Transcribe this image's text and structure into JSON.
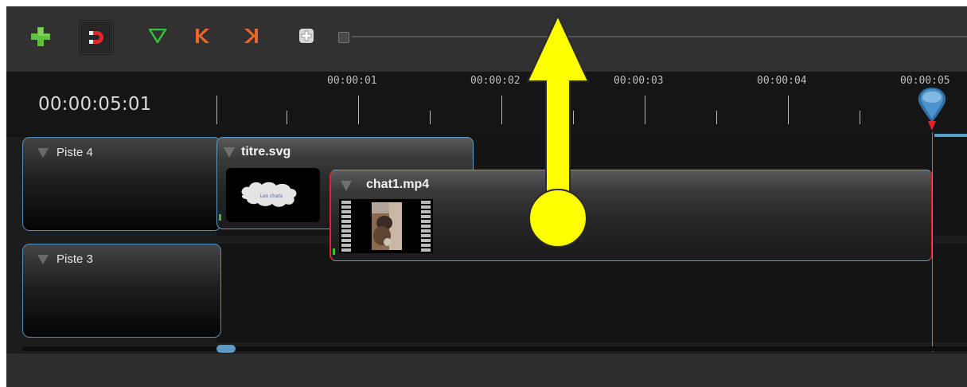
{
  "toolbar": {
    "buttons": [
      {
        "icon": "plus-icon",
        "color": "#5cc33a"
      },
      {
        "icon": "magnet-icon",
        "color": "#e2262c"
      },
      {
        "icon": "marker-icon",
        "color": "#36c13a"
      },
      {
        "icon": "previous-marker-icon",
        "color": "#e8682a"
      },
      {
        "icon": "next-marker-icon",
        "color": "#e8682a"
      },
      {
        "icon": "center-playhead-icon",
        "color": "#dcdcdc"
      }
    ]
  },
  "timeline": {
    "current_time": "00:00:05:01",
    "ruler_labels": [
      "00:00:01",
      "00:00:02",
      "00:00:03",
      "00:00:04",
      "00:00:05"
    ]
  },
  "tracks": [
    {
      "name": "Piste 4"
    },
    {
      "name": "Piste 3"
    }
  ],
  "clips": [
    {
      "name": "titre.svg",
      "thumb_text": "Les chats"
    },
    {
      "name": "chat1.mp4"
    }
  ],
  "colors": {
    "accent": "#5c9fc5",
    "playhead": "#2f6fa8",
    "annotation": "#ffff00",
    "selection": "#e0242a"
  }
}
